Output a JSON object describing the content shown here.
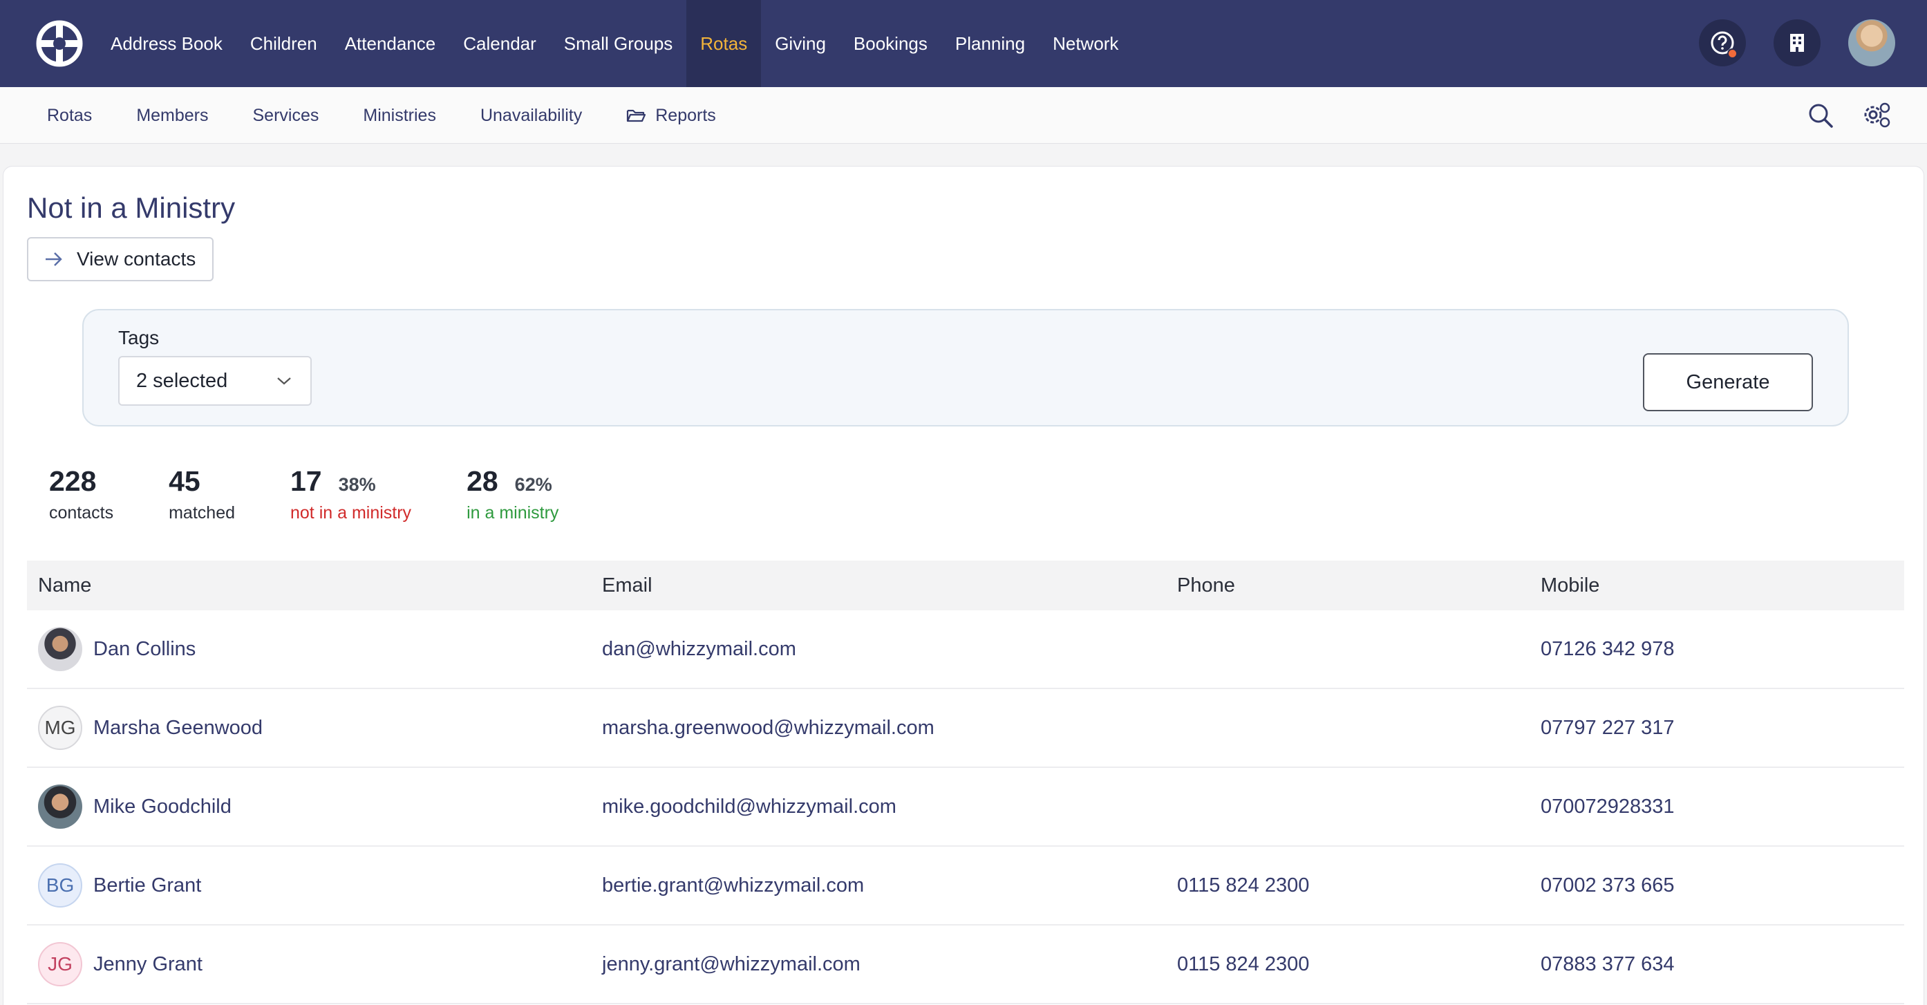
{
  "topnav": {
    "items": [
      {
        "label": "Address Book",
        "active": false
      },
      {
        "label": "Children",
        "active": false
      },
      {
        "label": "Attendance",
        "active": false
      },
      {
        "label": "Calendar",
        "active": false
      },
      {
        "label": "Small Groups",
        "active": false
      },
      {
        "label": "Rotas",
        "active": true
      },
      {
        "label": "Giving",
        "active": false
      },
      {
        "label": "Bookings",
        "active": false
      },
      {
        "label": "Planning",
        "active": false
      },
      {
        "label": "Network",
        "active": false
      }
    ],
    "icons": [
      "help-icon",
      "building-icon",
      "user-avatar"
    ],
    "colors": {
      "bar": "#343a6b",
      "active_text": "#f3b43a"
    }
  },
  "subnav": {
    "items": [
      {
        "label": "Rotas"
      },
      {
        "label": "Members"
      },
      {
        "label": "Services"
      },
      {
        "label": "Ministries"
      },
      {
        "label": "Unavailability"
      },
      {
        "label": "Reports",
        "icon": "folder-icon"
      }
    ],
    "icons": [
      "search-icon",
      "settings-icon"
    ]
  },
  "page": {
    "title": "Not in a Ministry",
    "view_contacts_label": "View contacts"
  },
  "filters": {
    "tags_label": "Tags",
    "tags_value": "2 selected",
    "generate_label": "Generate"
  },
  "stats": {
    "contacts": {
      "value": "228",
      "label": "contacts"
    },
    "matched": {
      "value": "45",
      "label": "matched"
    },
    "not_in_ministry": {
      "value": "17",
      "percent": "38%",
      "label": "not in a ministry"
    },
    "in_ministry": {
      "value": "28",
      "percent": "62%",
      "label": "in a ministry"
    }
  },
  "table": {
    "headers": {
      "name": "Name",
      "email": "Email",
      "phone": "Phone",
      "mobile": "Mobile"
    },
    "rows": [
      {
        "initials": "",
        "avatar": "photo",
        "name": "Dan Collins",
        "email": "dan@whizzymail.com",
        "phone": "",
        "mobile": "07126 342 978"
      },
      {
        "initials": "MG",
        "avatar": "grey",
        "name": "Marsha Geenwood",
        "email": "marsha.greenwood@whizzymail.com",
        "phone": "",
        "mobile": "07797 227 317"
      },
      {
        "initials": "",
        "avatar": "photo",
        "name": "Mike Goodchild",
        "email": "mike.goodchild@whizzymail.com",
        "phone": "",
        "mobile": "070072928331"
      },
      {
        "initials": "BG",
        "avatar": "blue",
        "name": "Bertie Grant",
        "email": "bertie.grant@whizzymail.com",
        "phone": "0115 824 2300",
        "mobile": "07002 373 665"
      },
      {
        "initials": "JG",
        "avatar": "pink",
        "name": "Jenny Grant",
        "email": "jenny.grant@whizzymail.com",
        "phone": "0115 824 2300",
        "mobile": "07883 377 634"
      }
    ]
  }
}
